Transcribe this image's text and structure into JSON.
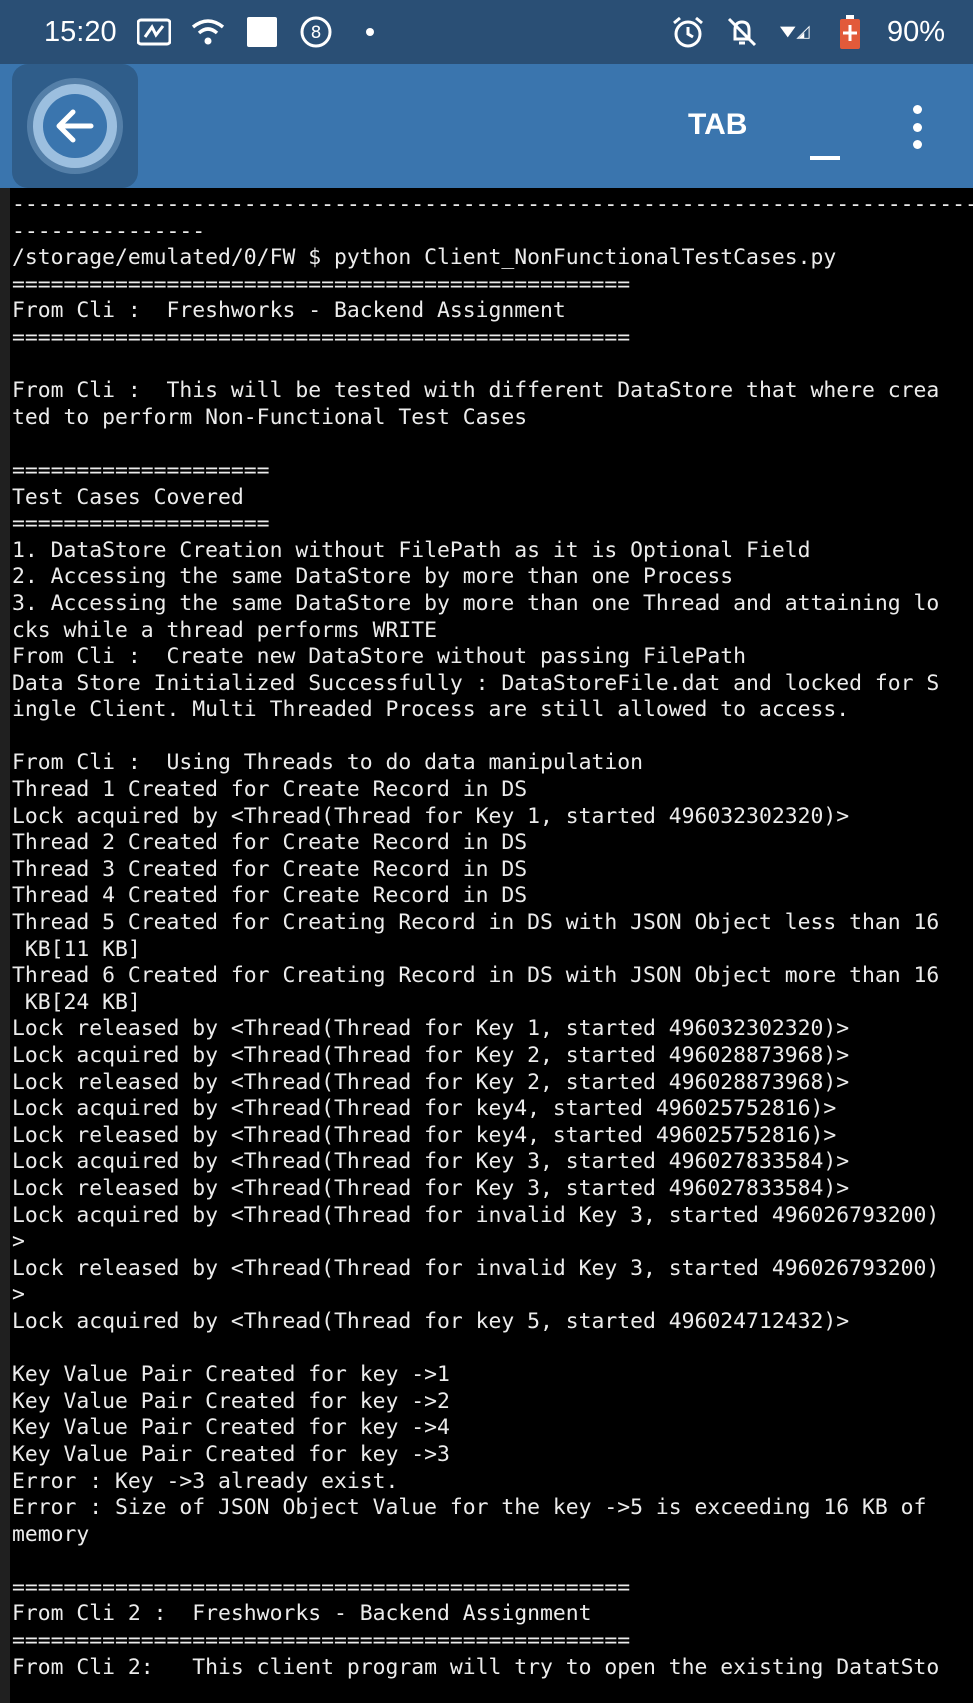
{
  "status_bar": {
    "time": "15:20",
    "battery": "90%",
    "icons_left": [
      "nfc-icon",
      "wifi-icon",
      "white-square-icon",
      "notification-8-icon",
      "dot-icon"
    ],
    "icons_right": [
      "alarm-icon",
      "mute-icon",
      "signal-icon",
      "battery-icon"
    ]
  },
  "app_bar": {
    "tab_label": "TAB"
  },
  "terminal": {
    "lines": [
      "---------------------------------------------------------------------------",
      "---------------",
      "/storage/emulated/0/FW $ python Client_NonFunctionalTestCases.py",
      "================================================",
      "From Cli :  Freshworks - Backend Assignment",
      "================================================",
      "",
      "From Cli :  This will be tested with different DataStore that where crea",
      "ted to perform Non-Functional Test Cases",
      "",
      "====================",
      "Test Cases Covered",
      "====================",
      "1. DataStore Creation without FilePath as it is Optional Field",
      "2. Accessing the same DataStore by more than one Process",
      "3. Accessing the same DataStore by more than one Thread and attaining lo",
      "cks while a thread performs WRITE",
      "From Cli :  Create new DataStore without passing FilePath",
      "Data Store Initialized Successfully : DataStoreFile.dat and locked for S",
      "ingle Client. Multi Threaded Process are still allowed to access.",
      "",
      "From Cli :  Using Threads to do data manipulation",
      "Thread 1 Created for Create Record in DS",
      "Lock acquired by <Thread(Thread for Key 1, started 496032302320)>",
      "Thread 2 Created for Create Record in DS",
      "Thread 3 Created for Create Record in DS",
      "Thread 4 Created for Create Record in DS",
      "Thread 5 Created for Creating Record in DS with JSON Object less than 16",
      " KB[11 KB]",
      "Thread 6 Created for Creating Record in DS with JSON Object more than 16",
      " KB[24 KB]",
      "Lock released by <Thread(Thread for Key 1, started 496032302320)>",
      "Lock acquired by <Thread(Thread for Key 2, started 496028873968)>",
      "Lock released by <Thread(Thread for Key 2, started 496028873968)>",
      "Lock acquired by <Thread(Thread for key4, started 496025752816)>",
      "Lock released by <Thread(Thread for key4, started 496025752816)>",
      "Lock acquired by <Thread(Thread for Key 3, started 496027833584)>",
      "Lock released by <Thread(Thread for Key 3, started 496027833584)>",
      "Lock acquired by <Thread(Thread for invalid Key 3, started 496026793200)",
      ">",
      "Lock released by <Thread(Thread for invalid Key 3, started 496026793200)",
      ">",
      "Lock acquired by <Thread(Thread for key 5, started 496024712432)>",
      "",
      "Key Value Pair Created for key ->1",
      "Key Value Pair Created for key ->2",
      "Key Value Pair Created for key ->4",
      "Key Value Pair Created for key ->3",
      "Error : Key ->3 already exist.",
      "Error : Size of JSON Object Value for the key ->5 is exceeding 16 KB of",
      "memory",
      "",
      "================================================",
      "From Cli 2 :  Freshworks - Backend Assignment",
      "================================================",
      "From Cli 2:   This client program will try to open the existing DatatSto"
    ]
  }
}
